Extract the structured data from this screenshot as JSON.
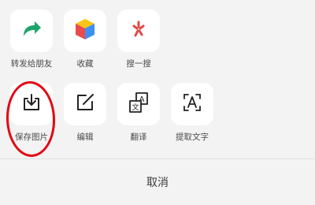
{
  "share_row": [
    {
      "label": "转发给朋友",
      "icon": "forward-arrow-icon"
    },
    {
      "label": "收藏",
      "icon": "cube-favorite-icon"
    },
    {
      "label": "搜一搜",
      "icon": "search-spark-icon"
    }
  ],
  "action_row": [
    {
      "label": "保存图片",
      "icon": "download-icon"
    },
    {
      "label": "编辑",
      "icon": "edit-icon"
    },
    {
      "label": "翻译",
      "icon": "translate-icon"
    },
    {
      "label": "提取文字",
      "icon": "text-extract-icon"
    }
  ],
  "cancel_label": "取消",
  "annotation": {
    "color": "#e30613",
    "target": "save-image-button"
  }
}
